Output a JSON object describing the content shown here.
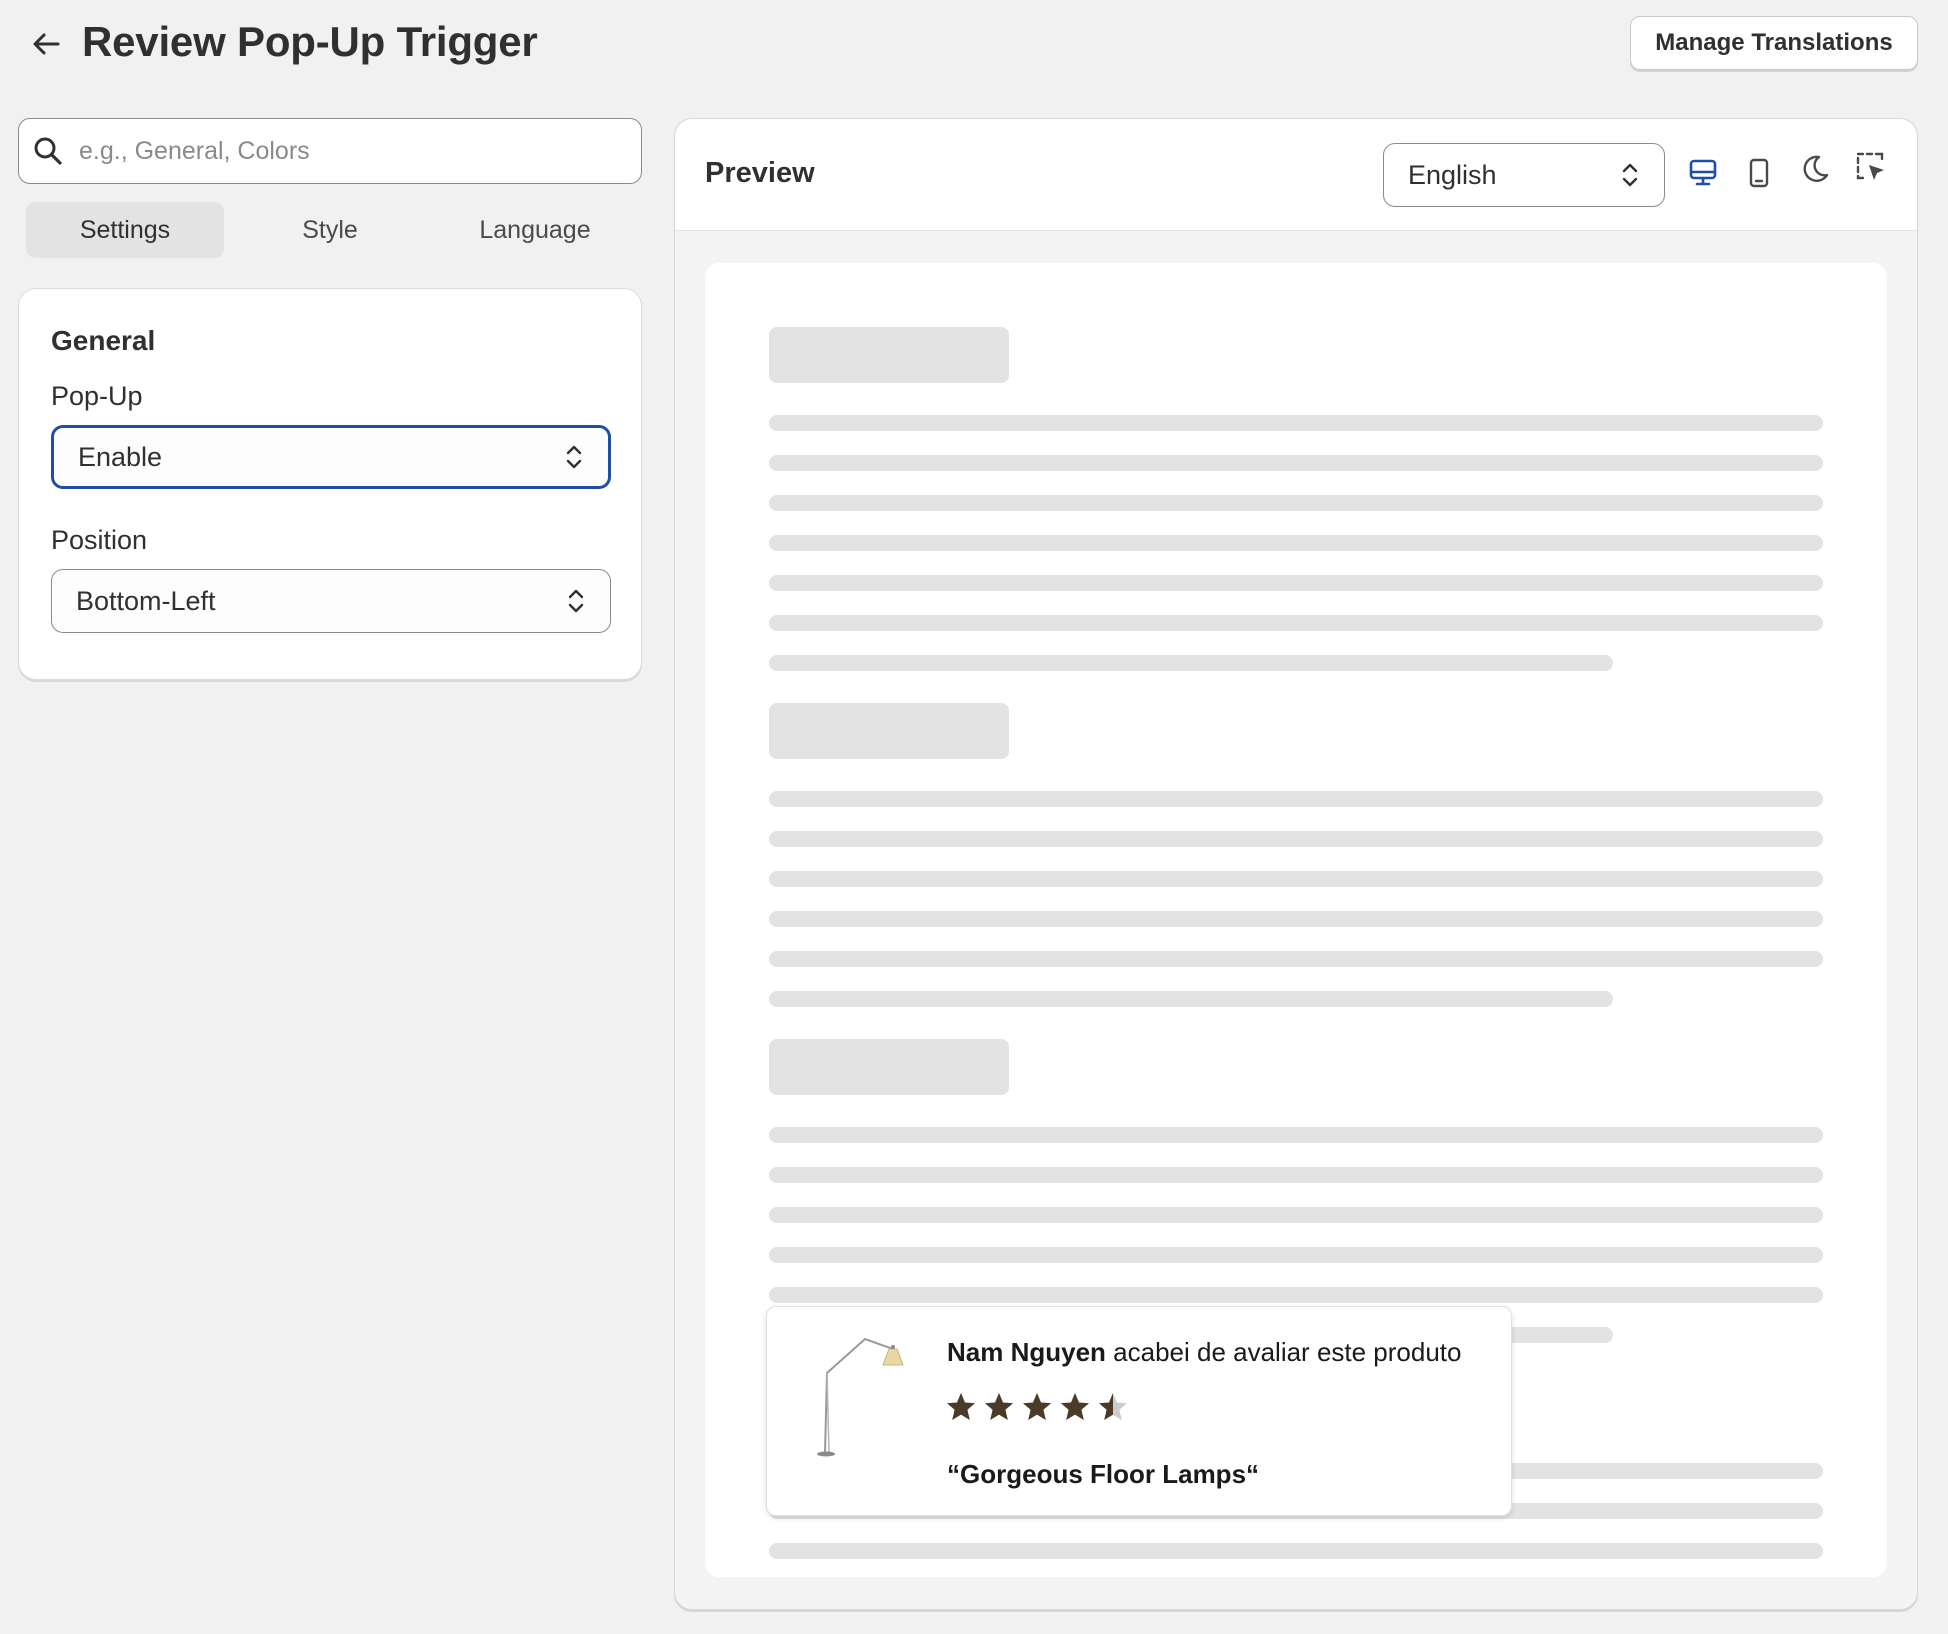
{
  "header": {
    "title": "Review Pop-Up Trigger",
    "manage_translations_label": "Manage Translations"
  },
  "search": {
    "placeholder": "e.g., General, Colors",
    "value": ""
  },
  "tabs": [
    {
      "label": "Settings",
      "active": true
    },
    {
      "label": "Style",
      "active": false
    },
    {
      "label": "Language",
      "active": false
    }
  ],
  "general": {
    "title": "General",
    "popup_label": "Pop-Up",
    "popup_value": "Enable",
    "position_label": "Position",
    "position_value": "Bottom-Left"
  },
  "preview": {
    "title": "Preview",
    "language_value": "English",
    "tools": [
      "desktop-icon",
      "mobile-icon",
      "dark-mode-icon",
      "select-element-icon"
    ]
  },
  "review_popup": {
    "reviewer_name": "Nam Nguyen",
    "message": " acabei de avaliar este produto",
    "rating": 4.5,
    "rating_max": 5,
    "quote": "“Gorgeous Floor Lamps“"
  },
  "colors": {
    "accent": "#1f4ea8",
    "star": "#4a3a28",
    "star_empty": "#cccccc",
    "skeleton": "#e3e3e3"
  }
}
